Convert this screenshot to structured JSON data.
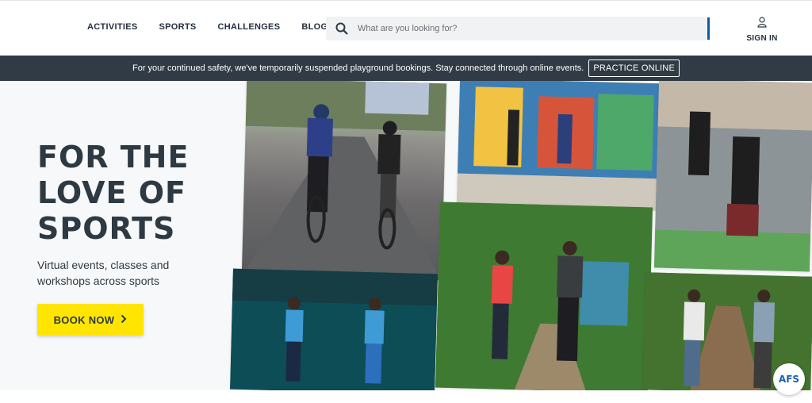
{
  "header": {
    "nav": [
      "ACTIVITIES",
      "SPORTS",
      "CHALLENGES",
      "BLOG"
    ],
    "search": {
      "placeholder": "What are you looking for?",
      "icon": "search-icon"
    },
    "signin": {
      "label": "SIGN IN",
      "icon": "user-icon"
    }
  },
  "banner": {
    "text": "For your continued safety, we've temporarily suspended playground bookings. Stay connected through online events.",
    "button": "PRACTICE ONLINE"
  },
  "hero": {
    "title_lines": [
      "FOR THE",
      "LOVE OF",
      "SPORTS"
    ],
    "subtitle": "Virtual events, classes and workshops across sports",
    "cta": "BOOK NOW"
  },
  "badge": {
    "label": "AFS"
  },
  "colors": {
    "accent": "#ffe500",
    "banner_bg": "#303b45",
    "heading": "#2d3a44"
  }
}
